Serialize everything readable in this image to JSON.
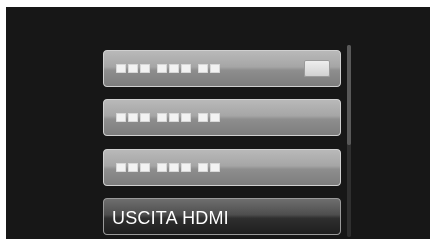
{
  "menu": {
    "items": [
      {
        "label": "",
        "has_value": true,
        "selected": false
      },
      {
        "label": "",
        "has_value": false,
        "selected": false
      },
      {
        "label": "",
        "has_value": false,
        "selected": false
      },
      {
        "label": "USCITA HDMI",
        "has_value": false,
        "selected": true
      }
    ]
  },
  "colors": {
    "screen_background": "#171717",
    "inactive_item": "#a6a6a6",
    "selected_item": "#3a3a3a",
    "selected_text": "#ffffff"
  },
  "scroll": {
    "position_fraction": 0.0
  }
}
